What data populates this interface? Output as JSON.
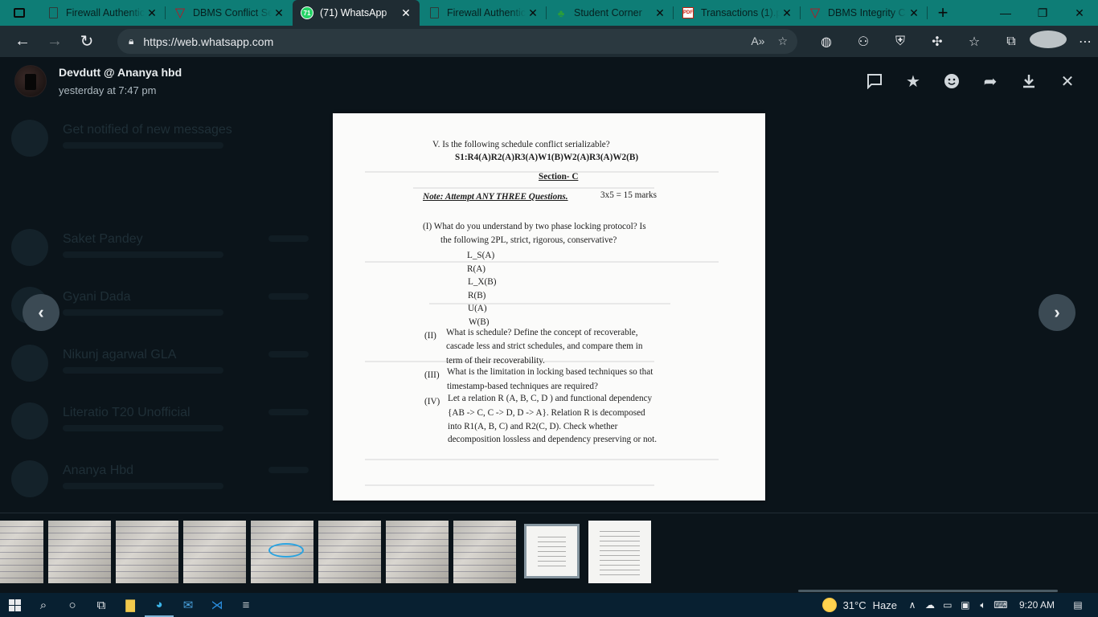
{
  "browser": {
    "tabs": [
      {
        "title": "Firewall Authentic",
        "favicon": "document-icon",
        "active": false
      },
      {
        "title": "DBMS Conflict Se",
        "favicon": "v-logo-icon",
        "active": false
      },
      {
        "title": "(71) WhatsApp",
        "favicon": "whatsapp-icon",
        "active": true
      },
      {
        "title": "Firewall Authentic",
        "favicon": "document-icon",
        "active": false
      },
      {
        "title": "Student Corner",
        "favicon": "student-corner-icon",
        "active": false
      },
      {
        "title": "Transactions (1).p",
        "favicon": "pdf-icon",
        "active": false
      },
      {
        "title": "DBMS Integrity C",
        "favicon": "v-logo-icon",
        "active": false
      }
    ],
    "url": "https://web.whatsapp.com",
    "favicon_badge": "71"
  },
  "viewer": {
    "sender_name": "Devdutt @ Ananya hbd",
    "timestamp": "yesterday at 7:47 pm"
  },
  "background_chats": [
    "Get notified of new messages",
    "Saket Pandey",
    "Gyani Dada",
    "Nikunj agarwal GLA",
    "Literatio T20 Unofficial",
    "Ananya Hbd"
  ],
  "document": {
    "q5_title": "V.  Is the following schedule conflict serializable?",
    "q5_schedule": "S1:R4(A)R2(A)R3(A)W1(B)W2(A)R3(A)W2(B)",
    "section": "Section- C",
    "note": "Note: Attempt ANY THREE Questions.",
    "marks": "3x5 = 15 marks",
    "q1_line1": "(I)   What do you understand by two phase locking protocol? Is",
    "q1_line2": "the following 2PL, strict, rigorous, conservative?",
    "ops": [
      "L_S(A)",
      "R(A)",
      "L_X(B)",
      "R(B)",
      "U(A)",
      "W(B)"
    ],
    "q2_num": "(II)",
    "q2_lines": [
      "What is schedule? Define the concept of recoverable,",
      "cascade less and strict schedules, and compare them in",
      "term of their recoverability."
    ],
    "q3_num": "(III)",
    "q3_lines": [
      "What is the limitation in locking based techniques so that",
      "timestamp-based techniques are required?"
    ],
    "q4_num": "(IV)",
    "q4_lines": [
      "Let a relation R (A, B, C, D ) and functional dependency",
      "{AB -> C, C -> D, D -> A}. Relation R is decomposed",
      "into  R1(A,  B,  C)  and  R2(C,  D).  Check  whether",
      "decomposition lossless and dependency preserving or not."
    ]
  },
  "taskbar": {
    "temperature": "31°C",
    "weather": "Haze",
    "time": "9:20 AM"
  }
}
